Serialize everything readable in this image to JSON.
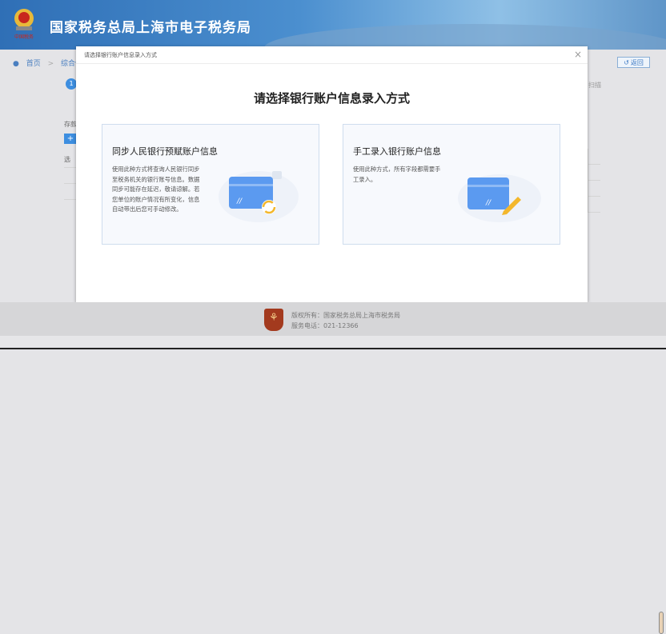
{
  "header": {
    "title": "国家税务总局上海市电子税务局",
    "emblem_text": "中国税务"
  },
  "breadcrumb": {
    "home": "首页",
    "separator": ">",
    "current": "综合信息"
  },
  "back_button": "返回",
  "background": {
    "step": "1",
    "side_text": "扫描",
    "deposit_label": "存款",
    "add": "+",
    "table_header": "选"
  },
  "modal": {
    "title": "请选择银行账户信息录入方式",
    "heading": "请选择银行账户信息录入方式",
    "close": "×",
    "options": [
      {
        "title": "同步人民银行预赋账户信息",
        "desc": "使用此种方式将查询人民银行同步至税务机关的银行账号信息。数据同步可能存在延迟，敬请谅解。若您单位的账户情况有所变化，信息自动带出后您可手动修改。",
        "icon": "bank-card-sync-icon"
      },
      {
        "title": "手工录入银行账户信息",
        "desc": "使用此种方式，所有字段都需要手工录入。",
        "icon": "bank-card-edit-icon"
      }
    ]
  },
  "footer": {
    "copyright": "版权所有：国家税务总局上海市税务局",
    "phone": "服务电话：021-12366"
  },
  "colors": {
    "accent": "#3d8ee0",
    "card_blue": "#5b9af0",
    "sync_yellow": "#f3b72c"
  }
}
